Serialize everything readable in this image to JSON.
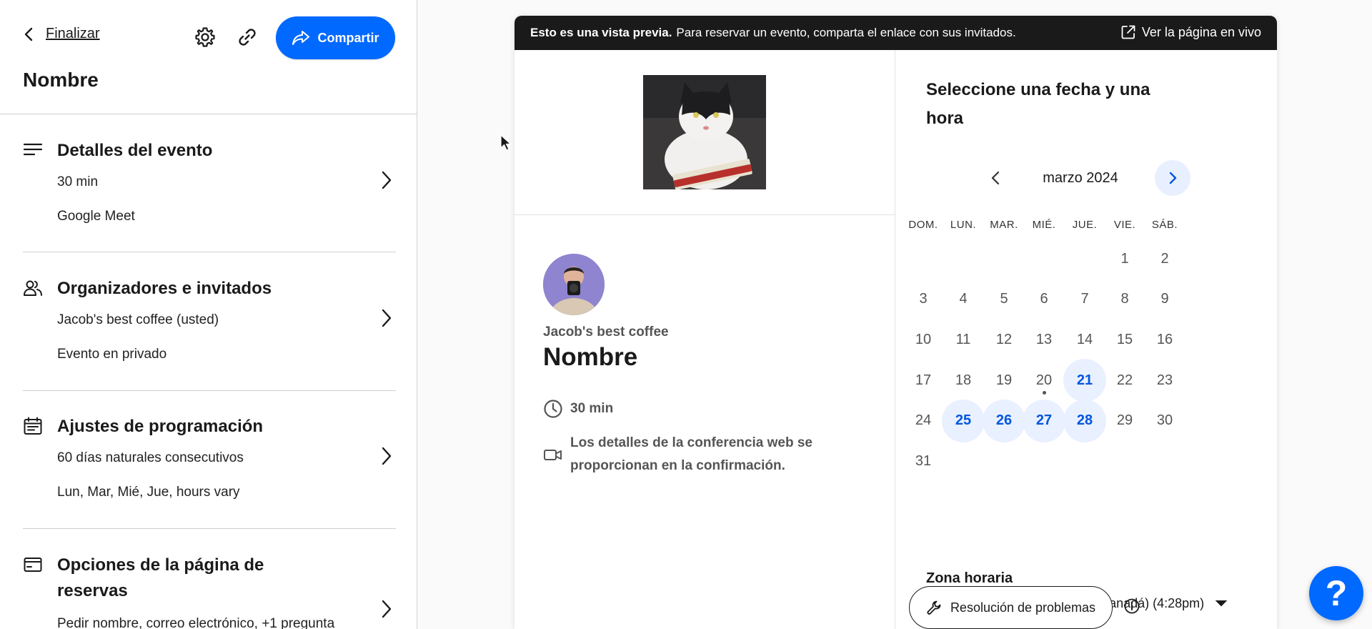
{
  "topbar": {
    "back_label": "Finalizar",
    "share_label": "Compartir",
    "event_title": "Nombre"
  },
  "sections": [
    {
      "title": "Detalles del evento",
      "lines": [
        "30 min",
        "Google Meet"
      ]
    },
    {
      "title": "Organizadores e invitados",
      "lines": [
        "Jacob's best coffee (usted)",
        "Evento en privado"
      ]
    },
    {
      "title": "Ajustes de programación",
      "lines": [
        "60 días naturales consecutivos",
        "Lun, Mar, Mié, Jue, hours vary"
      ]
    },
    {
      "title_line1": "Opciones de la página de",
      "title_line2": "reservas",
      "lines": [
        "Pedir nombre, correo electrónico, +1 pregunta"
      ]
    }
  ],
  "preview": {
    "banner_bold": "Esto es una vista previa.",
    "banner_text": "Para reservar un evento, comparta el enlace con sus invitados.",
    "live_label": "Ver la página en vivo",
    "host_name": "Jacob's best coffee",
    "event_name": "Nombre",
    "duration": "30 min",
    "conference_line1": "Los detalles de la conferencia web se",
    "conference_line2": "proporcionan en la confirmación.",
    "pick_title_line1": "Seleccione una fecha y una",
    "pick_title_line2": "hora",
    "month_label": "marzo 2024",
    "weekdays": [
      "DOM.",
      "LUN.",
      "MAR.",
      "MIÉ.",
      "JUE.",
      "VIE.",
      "SÁB."
    ],
    "available_days": [
      21,
      25,
      26,
      27,
      28
    ],
    "today": 20,
    "timezone_label": "Zona horaria",
    "timezone_value": "Hora del este (EE.UU. y Canadá) (4:28pm)"
  },
  "footer": {
    "troubleshoot_label": "Resolución de problemas",
    "help_label": "?"
  },
  "colors": {
    "accent": "#0069ff",
    "available_bg": "#e9f0ff",
    "available_text": "#0056e0",
    "banner_bg": "#1a1a1a"
  }
}
